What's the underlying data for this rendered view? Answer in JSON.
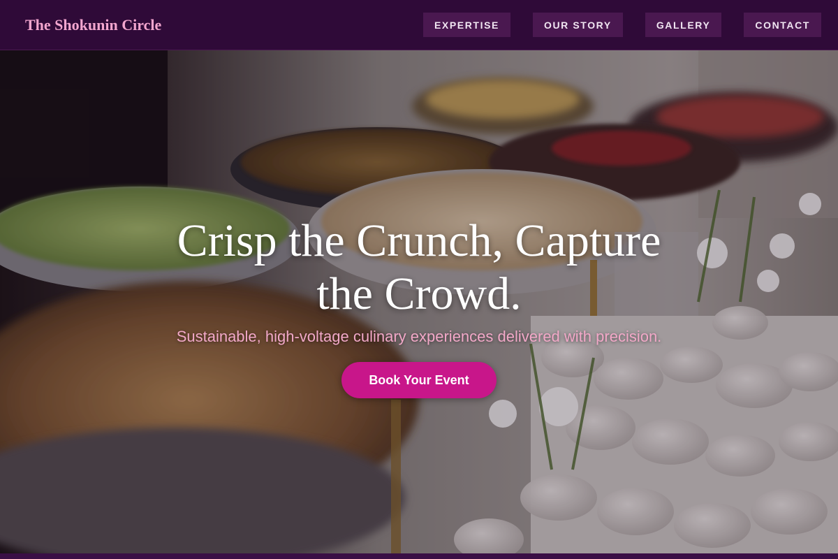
{
  "header": {
    "brand": "The Shokunin Circle",
    "nav": [
      {
        "label": "EXPERTISE"
      },
      {
        "label": "OUR STORY"
      },
      {
        "label": "GALLERY"
      },
      {
        "label": "CONTACT"
      }
    ]
  },
  "hero": {
    "title_line1": "Crisp the Crunch, Capture",
    "title_line2": "the Crowd.",
    "subtitle": "Sustainable, high-voltage culinary experiences delivered with precision.",
    "cta_label": "Book Your Event",
    "cta_color": "#c8168a"
  },
  "theme": {
    "nav_background": "#2f0a38",
    "brand_color": "#f3a6cf",
    "nav_button_background": "#4a1850",
    "subtitle_color": "#f2a8c8"
  }
}
